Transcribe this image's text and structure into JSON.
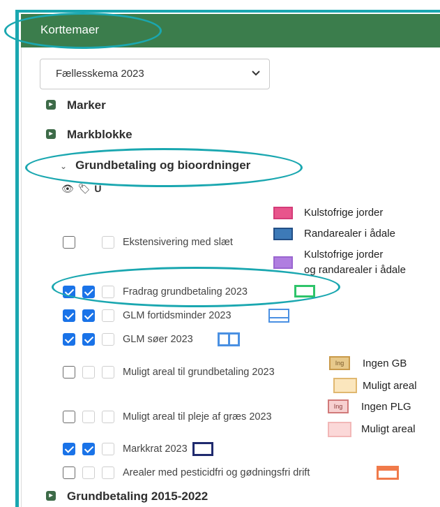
{
  "header": {
    "title": "Korttemaer"
  },
  "selector": {
    "value": "Fællesskema 2023"
  },
  "sections": {
    "marker": "Marker",
    "markblokke": "Markblokke",
    "grundbetaling": "Grundbetaling og bioordninger",
    "grundbetaling_old": "Grundbetaling 2015-2022"
  },
  "tool_icons": {
    "eye": "eye-icon",
    "tag": "tag-icon",
    "magnet": "magnet-icon"
  },
  "layers": [
    {
      "label": "Ekstensivering med slæt",
      "visible": false,
      "label_on": false
    },
    {
      "label": "Fradrag grundbetaling 2023",
      "visible": true,
      "label_on": true
    },
    {
      "label": "GLM fortidsminder 2023",
      "visible": true,
      "label_on": true
    },
    {
      "label": "GLM søer 2023",
      "visible": true,
      "label_on": true
    },
    {
      "label": "Muligt areal til grundbetaling 2023",
      "visible": false,
      "label_on": false
    },
    {
      "label": "Muligt areal til pleje af græs 2023",
      "visible": false,
      "label_on": false
    },
    {
      "label": "Markkrat 2023",
      "visible": true,
      "label_on": true
    },
    {
      "label": "Arealer med pesticidfri og gødningsfri drift",
      "visible": false,
      "label_on": false
    }
  ],
  "legends": {
    "ekstensivering": [
      {
        "label": "Kulstofrige jorder",
        "color": "#e8558c"
      },
      {
        "label": "Randarealer i ådale",
        "color": "#3d7ab8"
      },
      {
        "label": "Kulstofrige jorder",
        "label2": "og randarealer i ådale",
        "color": "#b07ee0"
      }
    ],
    "grundbetaling": [
      {
        "label": "Ingen GB",
        "code": "Ing",
        "color": "#e0b870"
      },
      {
        "label": "Muligt areal",
        "color": "#e8c98a"
      }
    ],
    "pleje": [
      {
        "label": "Ingen PLG",
        "code": "Ing",
        "color": "#e89a9a"
      },
      {
        "label": "Muligt areal",
        "color": "#f2b7b7"
      }
    ],
    "fradrag_color": "#2ec46a",
    "fortid_color": "#4a90e2",
    "soer_color": "#4a90e2",
    "markkrat_color": "#1f2a6e",
    "pesticid_color": "#f07a4a"
  }
}
